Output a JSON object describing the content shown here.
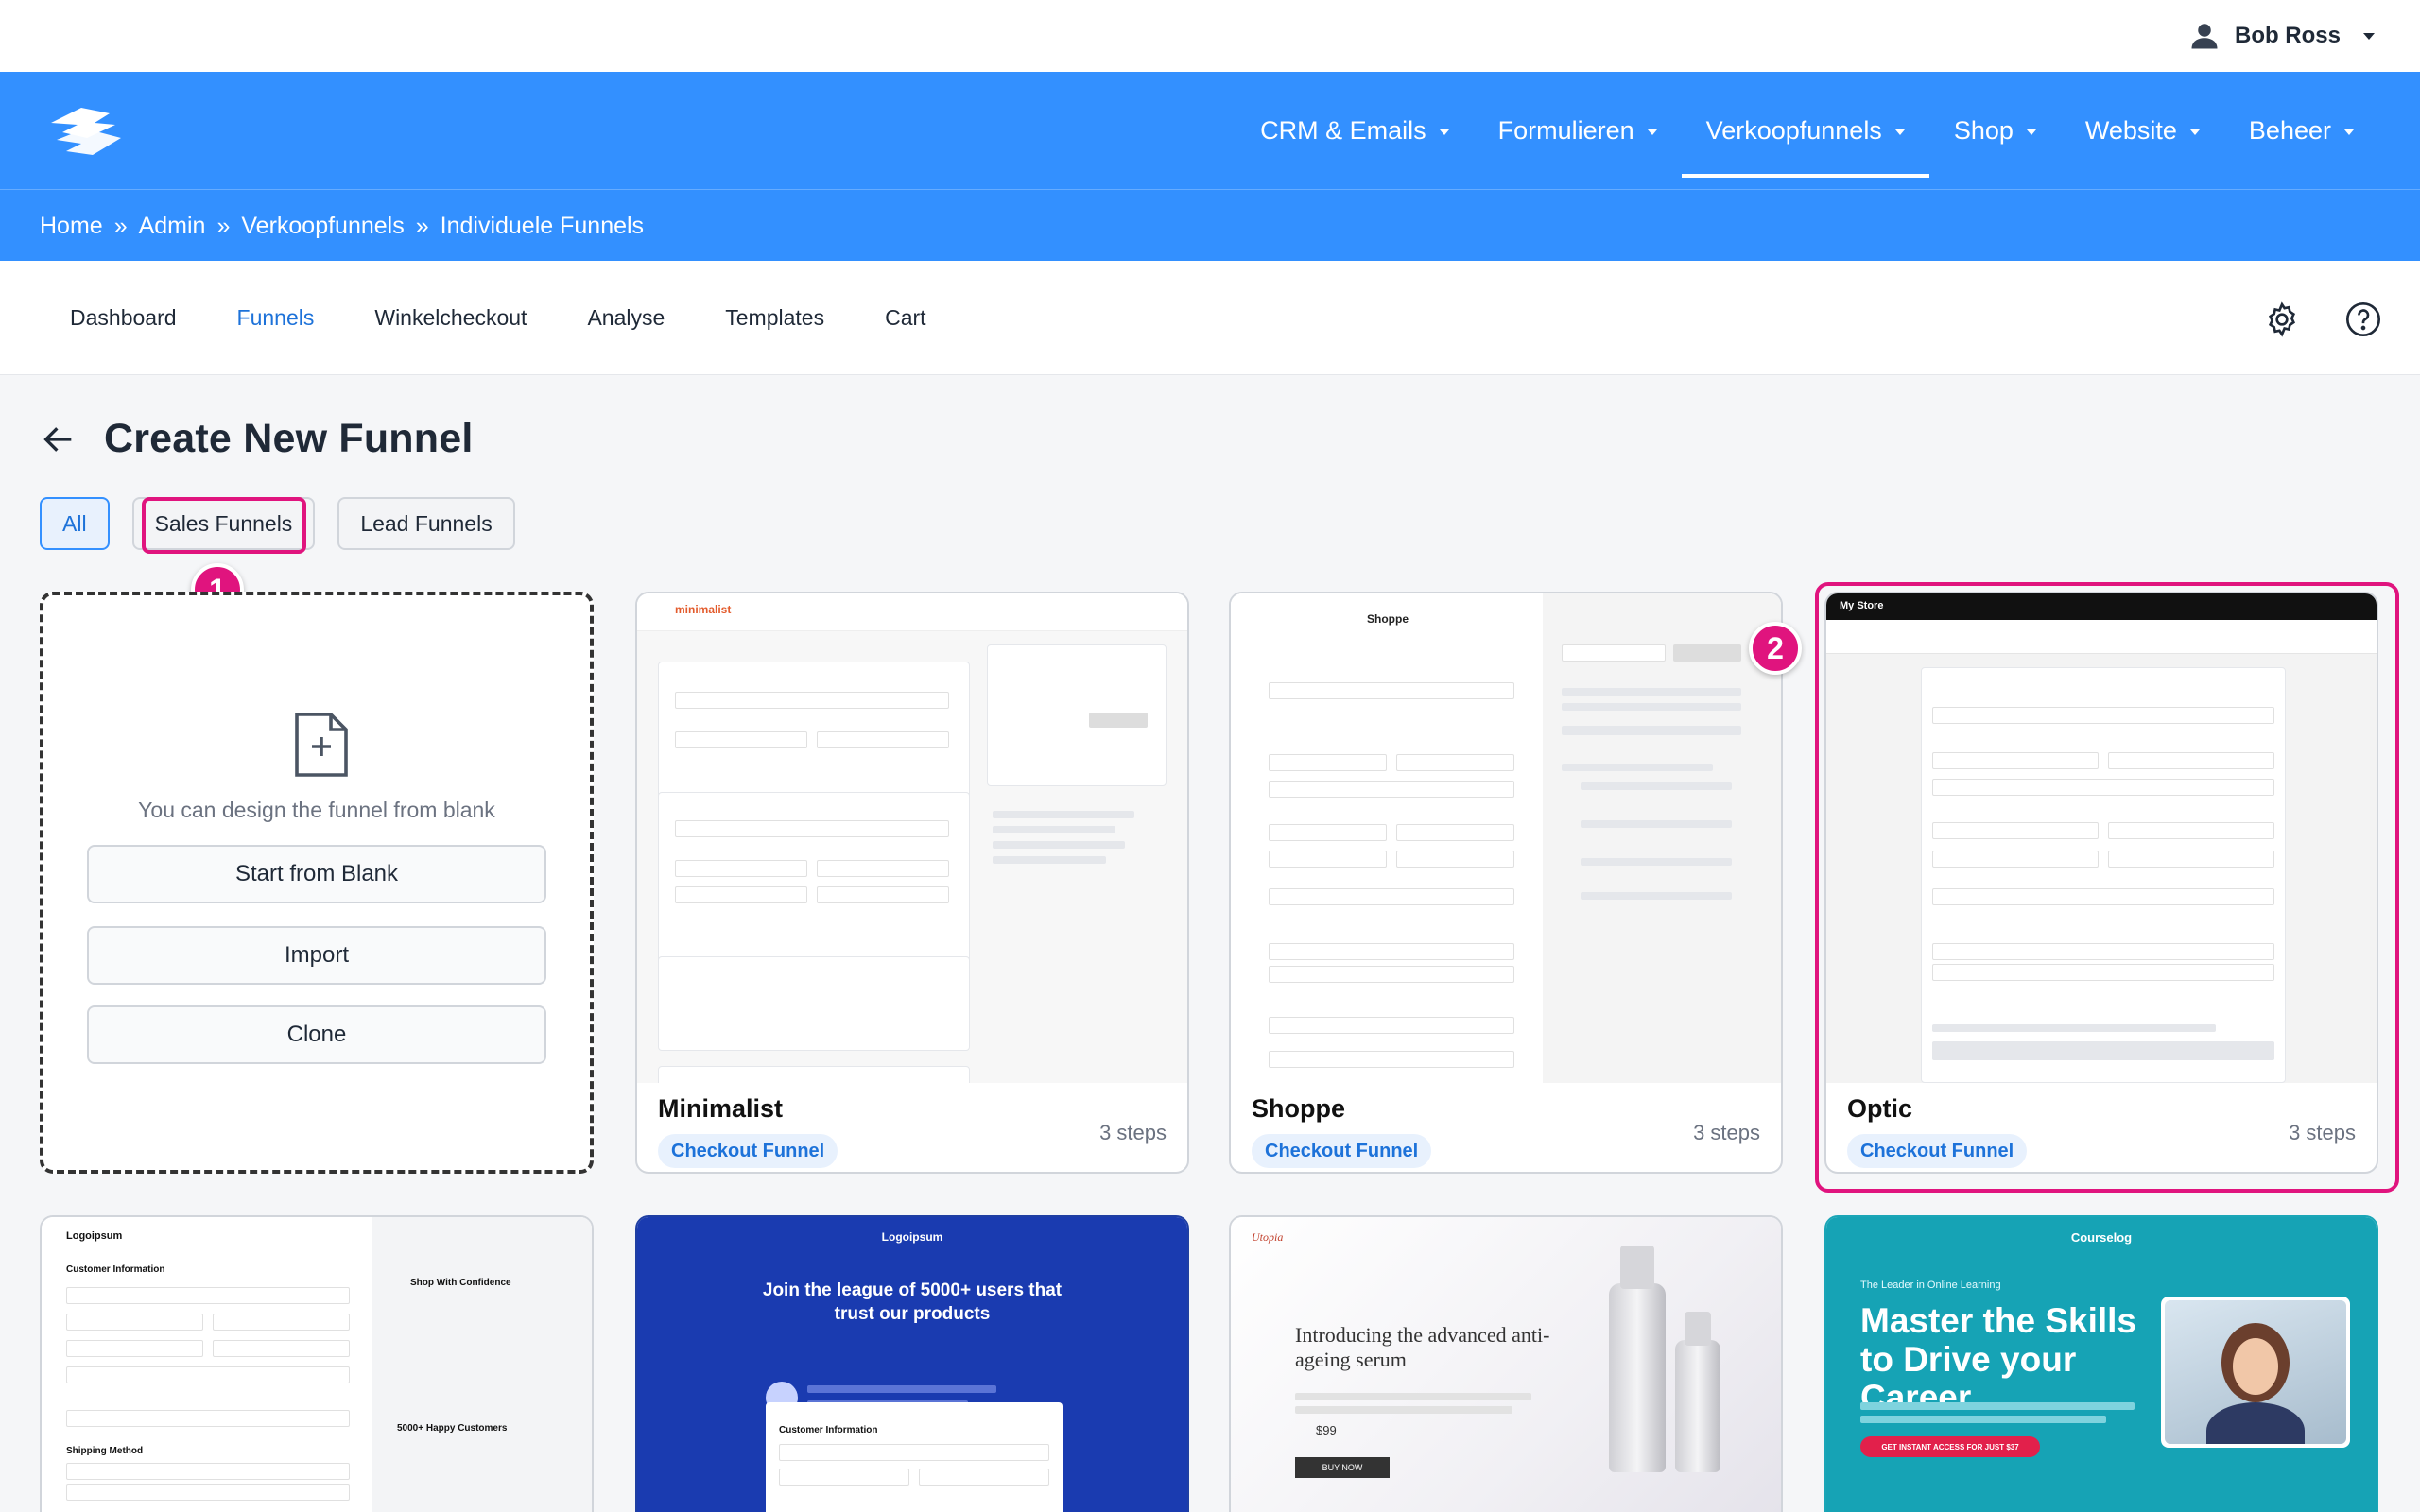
{
  "user": {
    "name": "Bob Ross"
  },
  "nav": {
    "items": [
      {
        "label": "CRM & Emails",
        "active": false
      },
      {
        "label": "Formulieren",
        "active": false
      },
      {
        "label": "Verkoopfunnels",
        "active": true
      },
      {
        "label": "Shop",
        "active": false
      },
      {
        "label": "Website",
        "active": false
      },
      {
        "label": "Beheer",
        "active": false
      }
    ]
  },
  "breadcrumb": [
    "Home",
    "Admin",
    "Verkoopfunnels",
    "Individuele Funnels"
  ],
  "breadcrumb_sep": "»",
  "subtabs": [
    "Dashboard",
    "Funnels",
    "Winkelcheckout",
    "Analyse",
    "Templates",
    "Cart"
  ],
  "page": {
    "title": "Create New Funnel"
  },
  "filters": [
    "All",
    "Sales Funnels",
    "Lead Funnels"
  ],
  "badges": [
    "1",
    "2"
  ],
  "blank": {
    "text": "You can design the funnel from blank",
    "buttons": [
      "Start from Blank",
      "Import",
      "Clone"
    ]
  },
  "templates": [
    {
      "name": "Minimalist",
      "tag": "Checkout Funnel",
      "steps": "3 steps",
      "brand": "minimalist"
    },
    {
      "name": "Shoppe",
      "tag": "Checkout Funnel",
      "steps": "3 steps",
      "brand": "Shoppe"
    },
    {
      "name": "Optic",
      "tag": "Checkout Funnel",
      "steps": "3 steps",
      "brand": "My Store"
    }
  ],
  "row2": {
    "card1": {
      "brand": "Logoipsum",
      "heading": "Customer Information",
      "sub": "Shop With Confidence",
      "happy": "5000+ Happy Customers",
      "shipping": "Shipping Method"
    },
    "card2": {
      "brand": "Logoipsum",
      "headline": "Join the league of 5000+ users that trust our products",
      "section": "Customer Information"
    },
    "card3": {
      "brand": "Utopia",
      "headline": "Introducing the advanced anti-ageing serum",
      "price": "$99",
      "cta": "BUY NOW"
    },
    "card4": {
      "brand": "Courselog",
      "eyebrow": "The Leader in Online Learning",
      "headline": "Master the Skills to Drive your Career.",
      "cta": "GET INSTANT ACCESS FOR JUST $37"
    }
  },
  "colors": {
    "primary": "#3390ff",
    "accent": "#e0147e",
    "tagbg": "#e8f1fd"
  }
}
